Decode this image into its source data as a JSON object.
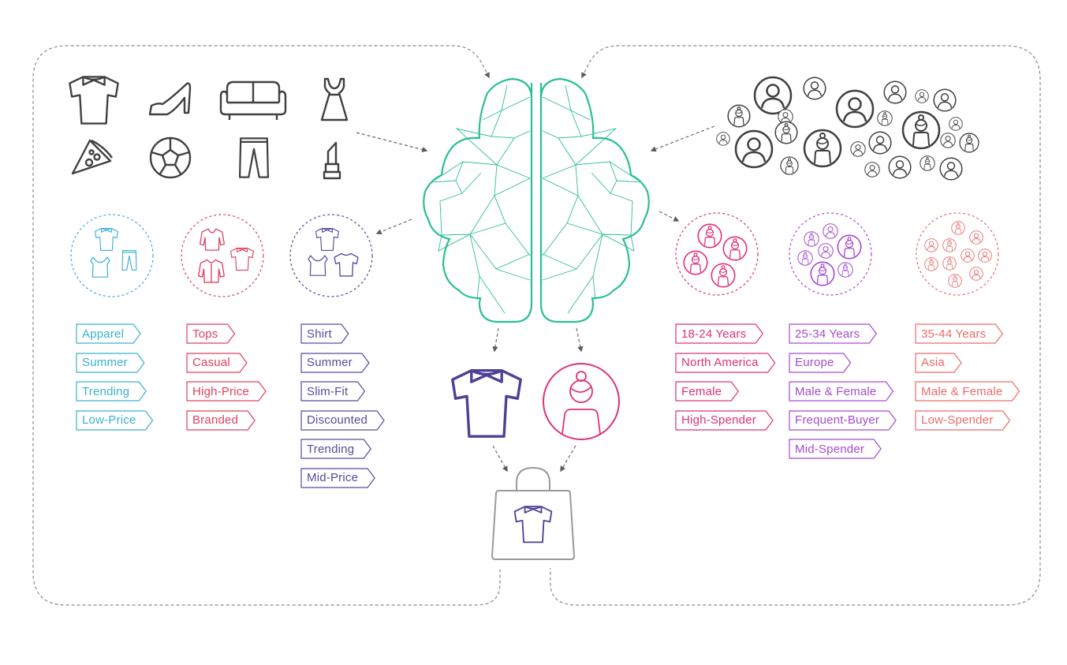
{
  "colors": {
    "brain": "#2bbf94",
    "connector": "#8a8a8a",
    "arrow": "#5a5a5a",
    "icon": "#404040",
    "bag": "#9a9a9a",
    "product_cluster": [
      "#3ab0cf",
      "#e0405e",
      "#5a4a9e"
    ],
    "user_cluster": [
      "#e0307a",
      "#a64ad0",
      "#ec6a6a"
    ],
    "highlight_product": "#4f3f96",
    "highlight_user": "#e0307a"
  },
  "products": {
    "catalog_icons": [
      "t-shirt-icon",
      "high-heel-icon",
      "sofa-icon",
      "dress-icon",
      "pizza-icon",
      "football-icon",
      "trousers-icon",
      "lipstick-icon"
    ],
    "clusters": [
      {
        "name": "product-cluster-1",
        "icons": [
          "t-shirt-icon",
          "tank-top-icon",
          "trousers-icon"
        ],
        "tags": [
          "Apparel",
          "Summer",
          "Trending",
          "Low-Price"
        ]
      },
      {
        "name": "product-cluster-2",
        "icons": [
          "sweater-icon",
          "cardigan-icon",
          "t-shirt-icon"
        ],
        "tags": [
          "Tops",
          "Casual",
          "High-Price",
          "Branded"
        ]
      },
      {
        "name": "product-cluster-3",
        "icons": [
          "t-shirt-icon",
          "tank-top-icon",
          "t-shirt-icon"
        ],
        "tags": [
          "Shirt",
          "Summer",
          "Slim-Fit",
          "Discounted",
          "Trending",
          "Mid-Price"
        ]
      }
    ]
  },
  "users": {
    "crowd_icon": "user-avatar-icon",
    "clusters": [
      {
        "name": "user-cluster-1",
        "tags": [
          "18-24 Years",
          "North America",
          "Female",
          "High-Spender"
        ]
      },
      {
        "name": "user-cluster-2",
        "tags": [
          "25-34 Years",
          "Europe",
          "Male & Female",
          "Frequent-Buyer",
          "Mid-Spender"
        ]
      },
      {
        "name": "user-cluster-3",
        "tags": [
          "35-44 Years",
          "Asia",
          "Male & Female",
          "Low-Spender"
        ]
      }
    ]
  },
  "center": {
    "brain_icon": "ai-brain-icon"
  },
  "match": {
    "product_icon": "t-shirt-icon",
    "user_icon": "female-user-icon",
    "result_icon": "shopping-bag-icon"
  }
}
